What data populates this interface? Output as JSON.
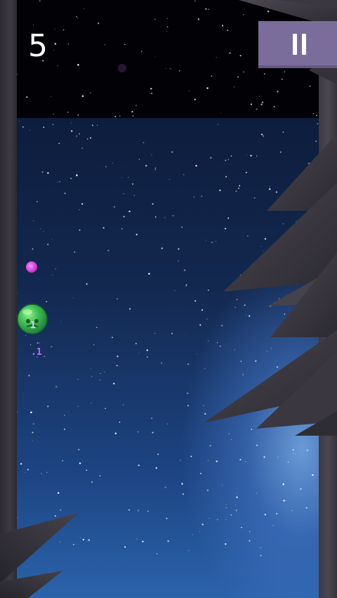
{
  "hud": {
    "score": "5",
    "pause_icon": "pause-icon"
  },
  "player": {
    "trail_label_top": "1",
    "trail_label_bottom": ".1"
  },
  "colors": {
    "pause_button": "#7a6d9c",
    "sky_top": "#0d1d3d",
    "sky_bottom": "#2b63ab",
    "wall": "#3d3a43",
    "spike": "#3a3740",
    "player": "#3fbf55",
    "orb": "#d040d8"
  }
}
